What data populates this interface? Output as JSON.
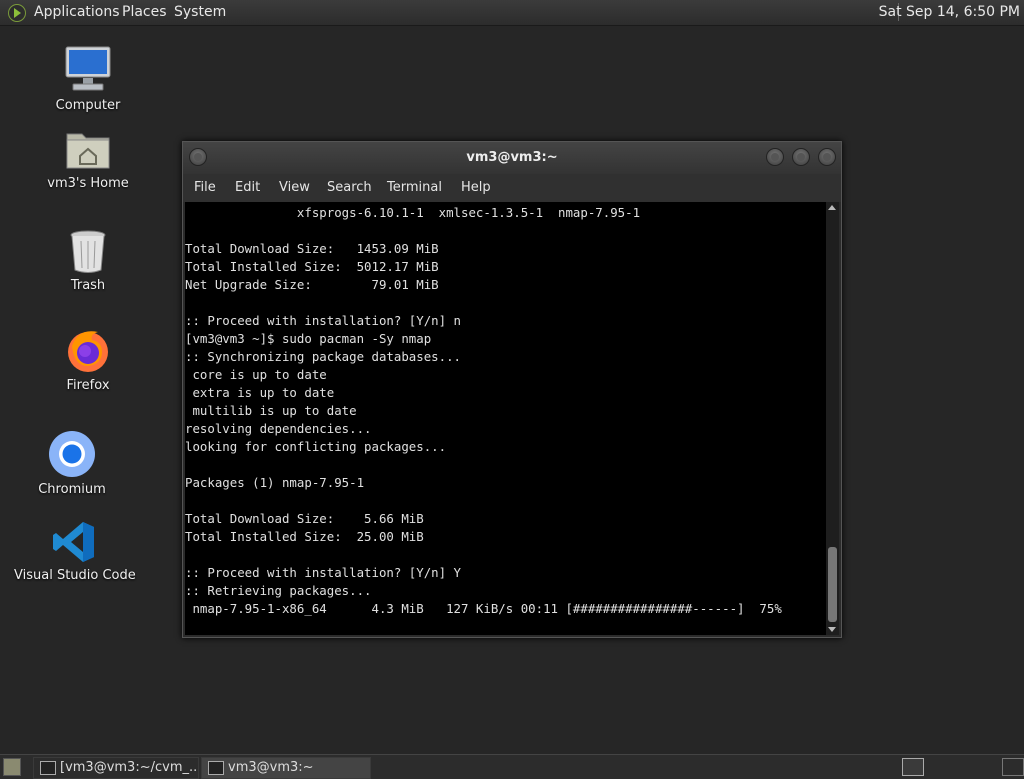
{
  "top_panel": {
    "applications": "Applications",
    "places": "Places",
    "system": "System",
    "clock": "Sat Sep 14,  6:50 PM"
  },
  "desktop_icons": {
    "computer": "Computer",
    "home": "vm3's Home",
    "trash": "Trash",
    "firefox": "Firefox",
    "chromium": "Chromium",
    "vscode": "Visual Studio Code"
  },
  "terminal": {
    "title": "vm3@vm3:~",
    "menu": [
      "File",
      "Edit",
      "View",
      "Search",
      "Terminal",
      "Help"
    ],
    "lines": [
      "               xfsprogs-6.10.1-1  xmlsec-1.3.5-1  nmap-7.95-1",
      "",
      "Total Download Size:   1453.09 MiB",
      "Total Installed Size:  5012.17 MiB",
      "Net Upgrade Size:        79.01 MiB",
      "",
      ":: Proceed with installation? [Y/n] n",
      "[vm3@vm3 ~]$ sudo pacman -Sy nmap",
      ":: Synchronizing package databases...",
      " core is up to date",
      " extra is up to date",
      " multilib is up to date",
      "resolving dependencies...",
      "looking for conflicting packages...",
      "",
      "Packages (1) nmap-7.95-1",
      "",
      "Total Download Size:    5.66 MiB",
      "Total Installed Size:  25.00 MiB",
      "",
      ":: Proceed with installation? [Y/n] Y",
      ":: Retrieving packages...",
      " nmap-7.95-1-x86_64      4.3 MiB   127 KiB/s 00:11 [################------]  75%"
    ],
    "download_progress_percent": 75
  },
  "taskbar": {
    "tasks": [
      "[vm3@vm3:~/cvm_...",
      "vm3@vm3:~"
    ]
  },
  "colors": {
    "desktop_bg": "#262626",
    "terminal_bg": "#000000",
    "terminal_fg": "#e0e0e0"
  }
}
